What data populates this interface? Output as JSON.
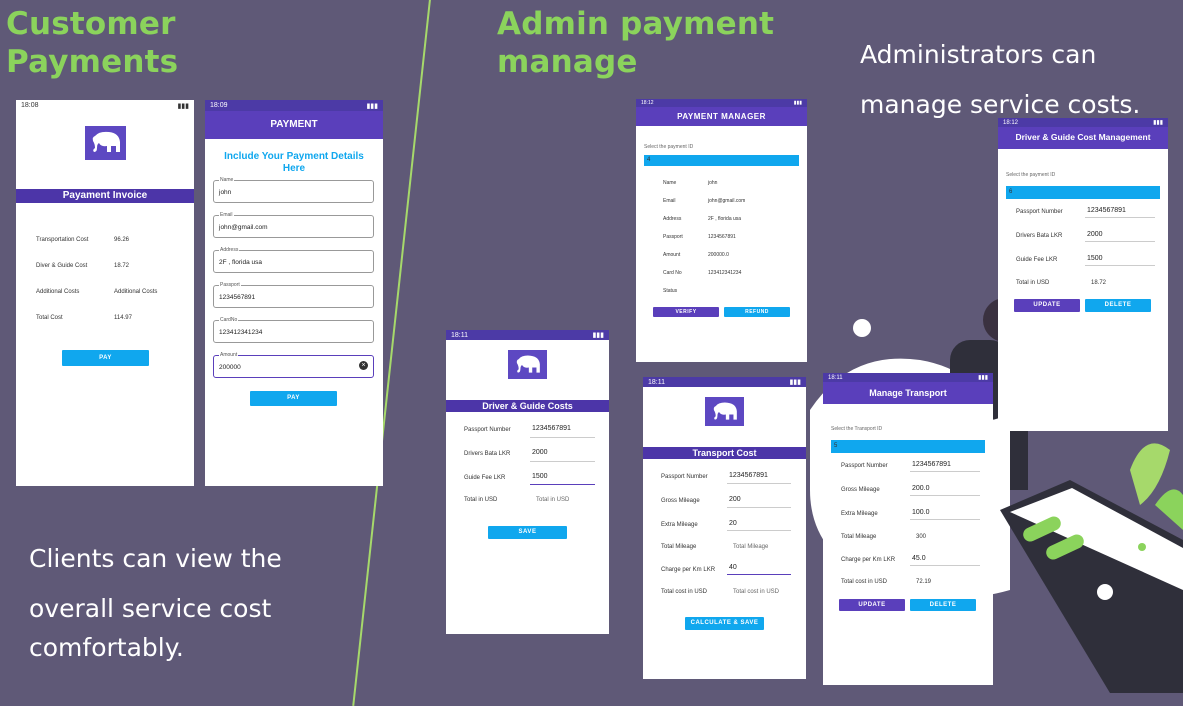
{
  "headings": {
    "customer_line1": "Customer",
    "customer_line2": "Payments",
    "admin_line1": "Admin payment",
    "admin_line2": "manage"
  },
  "captions": {
    "clients_line1": "Clients can view the",
    "clients_line2": "overall service cost",
    "clients_line3": "comfortably.",
    "admins_line1": "Administrators can",
    "admins_line2": "manage service costs."
  },
  "colors": {
    "accent_green": "#8bd35c",
    "primary_purple": "#5a3fbb",
    "button_blue": "#10a7ee",
    "background": "#5f5977"
  },
  "invoice_screen": {
    "time": "18:08",
    "title": "Payament Invoice",
    "rows": [
      {
        "label": "Transportation Cost",
        "value": "96.26"
      },
      {
        "label": "Diver & Guide Cost",
        "value": "18.72"
      },
      {
        "label": "Additional Costs",
        "value": "Additional Costs"
      },
      {
        "label": "Total Cost",
        "value": "114.97"
      }
    ],
    "pay_button": "PAY"
  },
  "payment_screen": {
    "time": "18:09",
    "appbar": "PAYMENT",
    "title": "Include Your Payment Details Here",
    "fields": [
      {
        "label": "Name",
        "value": "john"
      },
      {
        "label": "Email",
        "value": "john@gmail.com"
      },
      {
        "label": "Address",
        "value": "2F , florida usa"
      },
      {
        "label": "Passport",
        "value": "1234567891"
      },
      {
        "label": "CardNo",
        "value": "123412341234"
      },
      {
        "label": "Amount",
        "value": "200000"
      }
    ],
    "pay_button": "PAY"
  },
  "driver_cost_screen": {
    "time": "18:11",
    "title": "Driver & Guide Costs",
    "rows": [
      {
        "label": "Passport Number",
        "value": "1234567891"
      },
      {
        "label": "Drivers Bata LKR",
        "value": "2000"
      },
      {
        "label": "Guide Fee LKR",
        "value": "1500"
      },
      {
        "label": "Total in USD",
        "value": "Total in USD"
      }
    ],
    "save_button": "SAVE"
  },
  "payment_manager_screen": {
    "time": "18:12",
    "appbar": "PAYMENT MANAGER",
    "select_label": "Select the payment ID",
    "selected": "4",
    "rows": [
      {
        "label": "Name",
        "value": "john"
      },
      {
        "label": "Email",
        "value": "john@gmail.com"
      },
      {
        "label": "Address",
        "value": "2F , florida usa"
      },
      {
        "label": "Passport",
        "value": "1234567891"
      },
      {
        "label": "Amount",
        "value": "200000.0"
      },
      {
        "label": "Card No",
        "value": "123412341234"
      },
      {
        "label": "Status",
        "value": ""
      }
    ],
    "verify_button": "VERIFY",
    "refund_button": "REFUND"
  },
  "transport_cost_screen": {
    "time": "18:11",
    "title": "Transport Cost",
    "rows": [
      {
        "label": "Passport Number",
        "value": "1234567891"
      },
      {
        "label": "Gross Mileage",
        "value": "200"
      },
      {
        "label": "Extra Mileage",
        "value": "20"
      },
      {
        "label": "Total Mileage",
        "value": "Total Mileage"
      },
      {
        "label": "Charge per Km LKR",
        "value": "40"
      },
      {
        "label": "Total cost in USD",
        "value": "Total cost in USD"
      }
    ],
    "save_button": "CALCULATE & SAVE"
  },
  "manage_transport_screen": {
    "time": "18:11",
    "appbar": "Manage Transport",
    "select_label": "Select the Transport ID",
    "selected": "5",
    "rows": [
      {
        "label": "Passport Number",
        "value": "1234567891"
      },
      {
        "label": "Gross Mileage",
        "value": "200.0"
      },
      {
        "label": "Extra Mileage",
        "value": "100.0"
      },
      {
        "label": "Total Mileage",
        "value": "300"
      },
      {
        "label": "Charge per Km LKR",
        "value": "45.0"
      },
      {
        "label": "Total cost in USD",
        "value": "72.19"
      }
    ],
    "update_button": "UPDATE",
    "delete_button": "DELETE"
  },
  "guide_mgmt_screen": {
    "time": "18:12",
    "appbar": "Driver & Guide Cost Management",
    "select_label": "Select the payment ID",
    "selected": "6",
    "rows": [
      {
        "label": "Passport Number",
        "value": "1234567891"
      },
      {
        "label": "Drivers Bata LKR",
        "value": "2000"
      },
      {
        "label": "Guide Fee LKR",
        "value": "1500"
      },
      {
        "label": "Total in USD",
        "value": "18.72"
      }
    ],
    "update_button": "UPDATE",
    "delete_button": "DELETE"
  }
}
